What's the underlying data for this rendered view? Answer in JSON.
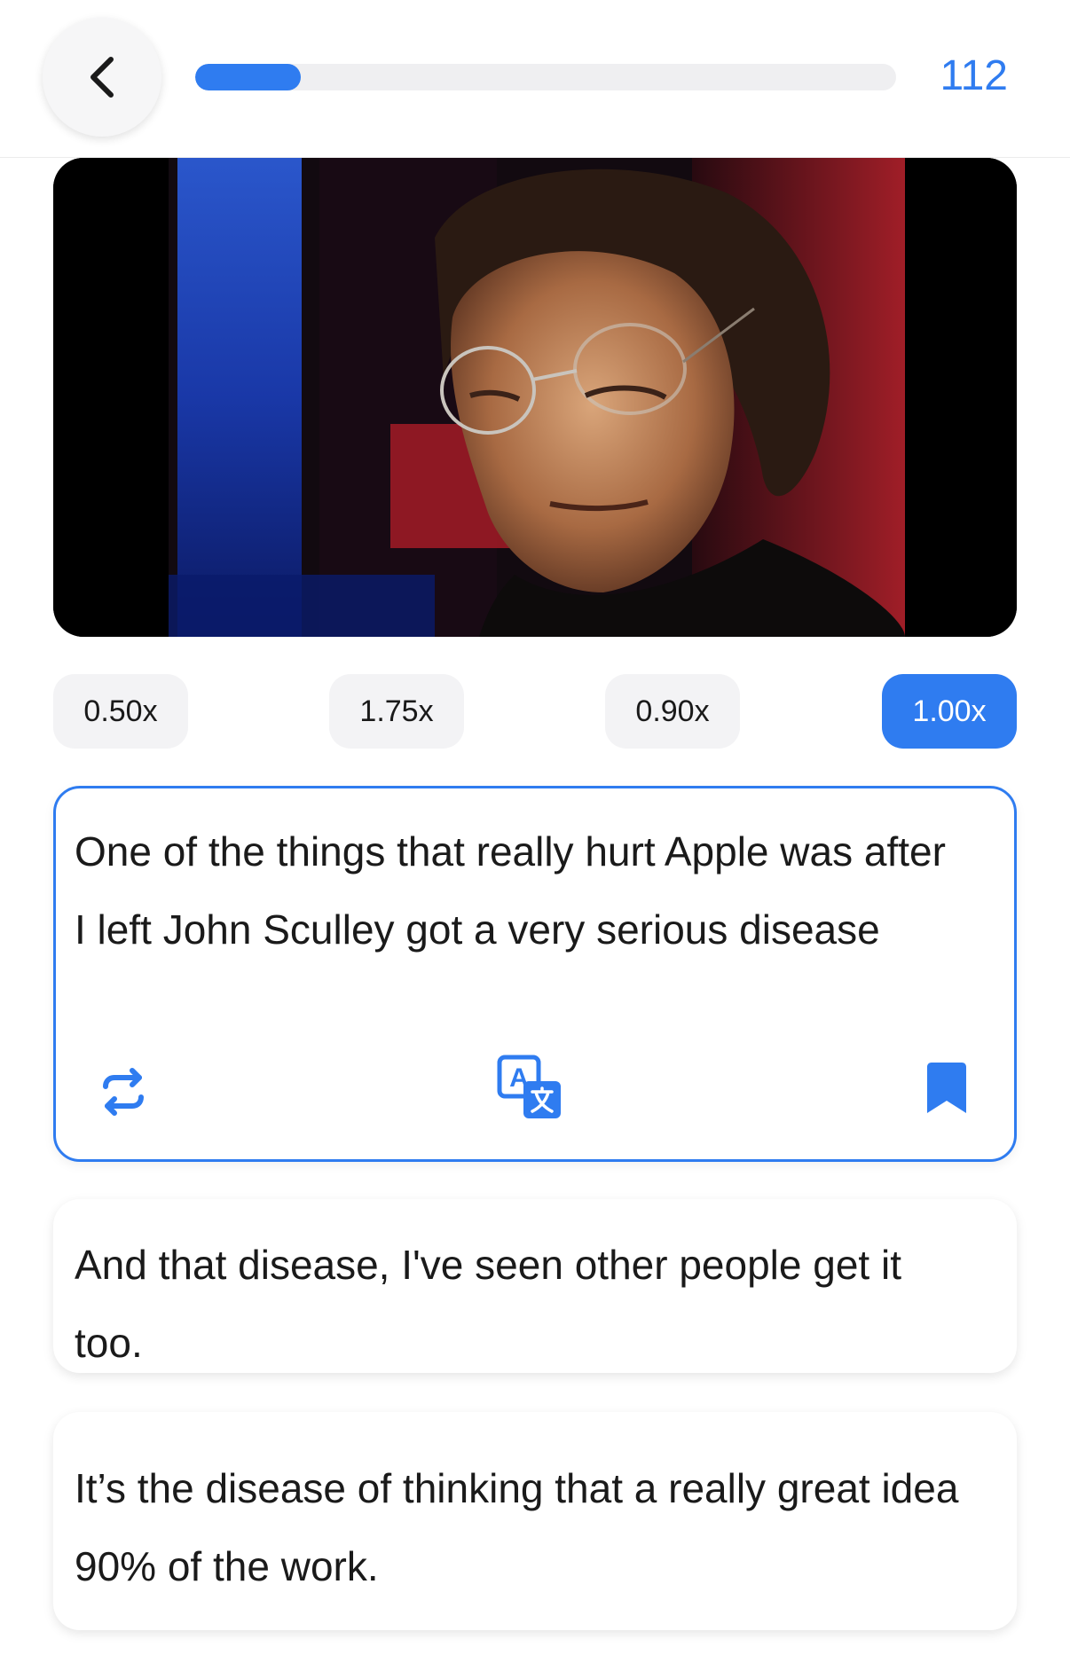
{
  "header": {
    "back_icon": "chevron-left-icon",
    "progress_fraction": 0.15,
    "counter": "112",
    "accent_color": "#2f7cf0"
  },
  "video": {
    "description_icon": "video-frame"
  },
  "speed_options": [
    {
      "label": "0.50x",
      "active": false
    },
    {
      "label": "1.75x",
      "active": false
    },
    {
      "label": "0.90x",
      "active": false
    },
    {
      "label": "1.00x",
      "active": true
    }
  ],
  "sentences": [
    {
      "text": "One of the things that really hurt Apple was after I left John Sculley got a very serious disease",
      "active": true,
      "actions": [
        "repeat-icon",
        "translate-icon",
        "bookmark-icon"
      ]
    },
    {
      "text": "And that disease, I've seen other people get it too.",
      "active": false
    },
    {
      "text": "It’s the disease of thinking that a really great idea 90% of the work.",
      "active": false
    }
  ]
}
